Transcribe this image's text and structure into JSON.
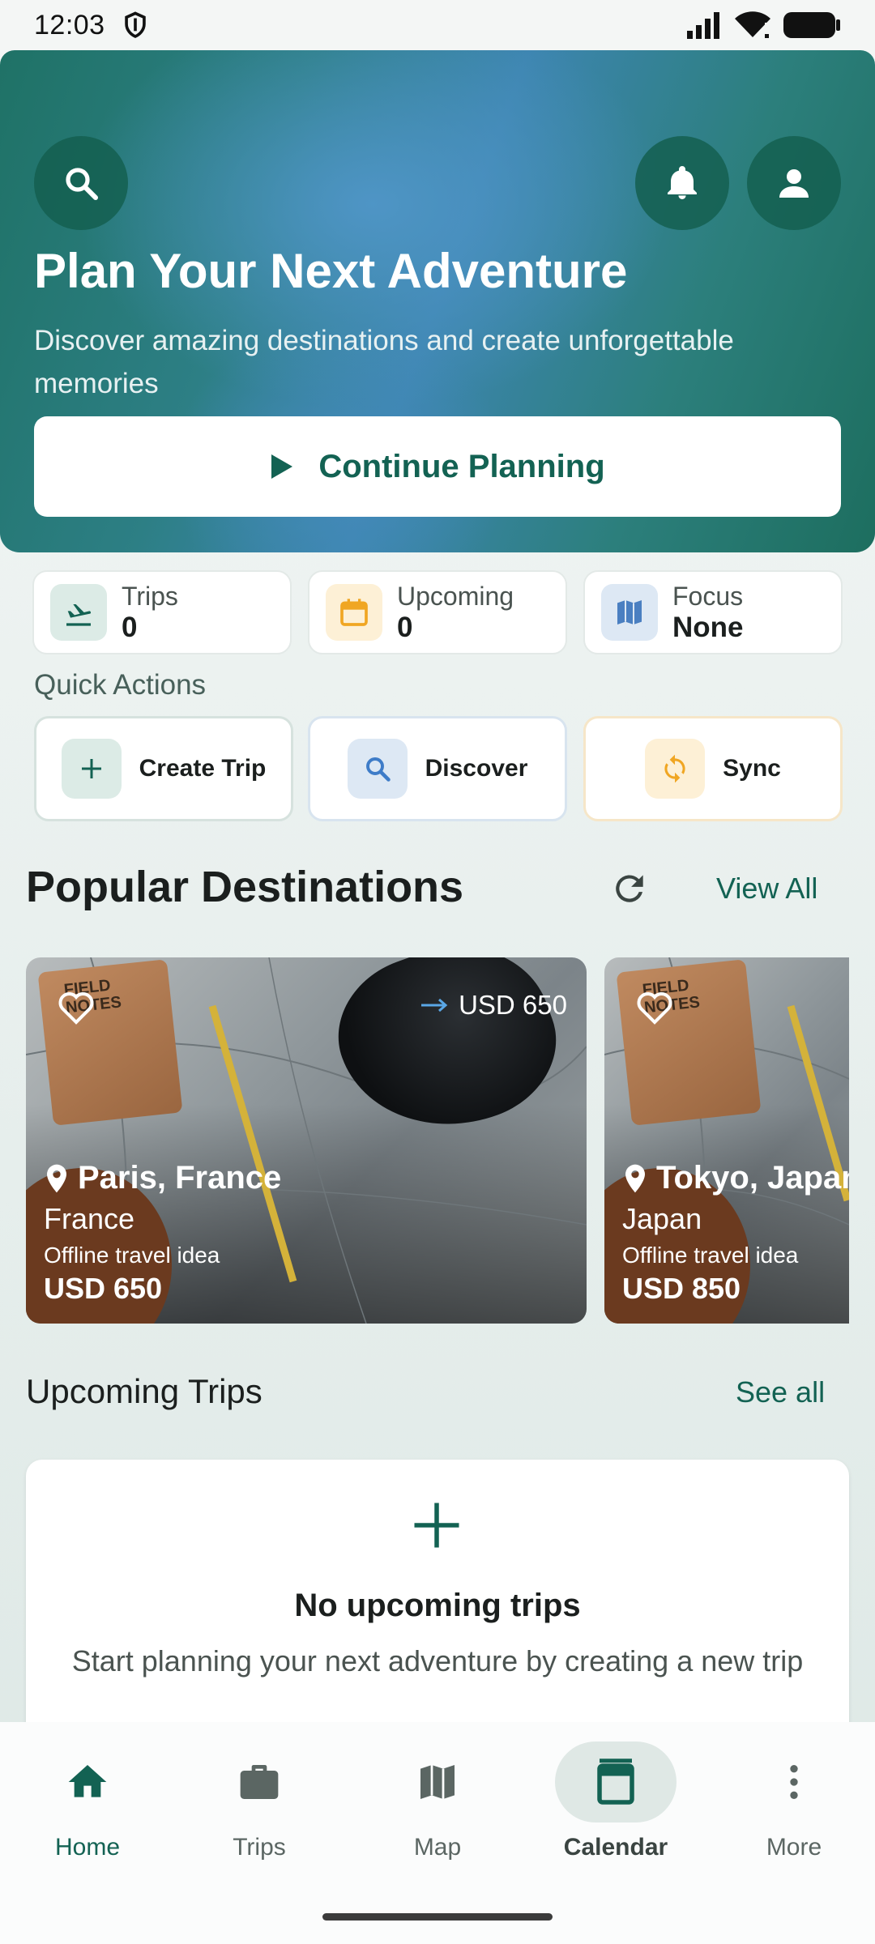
{
  "status_bar": {
    "time": "12:03",
    "icons": [
      "shield-icon",
      "signal-icon",
      "wifi-icon",
      "battery-icon"
    ]
  },
  "hero": {
    "title": "Plan Your Next Adventure",
    "subtitle": "Discover amazing destinations and create unforgettable memories",
    "cta_label": "Continue Planning",
    "icons": [
      "search-icon",
      "bell-icon",
      "person-icon",
      "play-icon"
    ]
  },
  "stats": [
    {
      "label": "Trips",
      "value": "0",
      "icon": "flight-land-icon"
    },
    {
      "label": "Upcoming",
      "value": "0",
      "icon": "calendar-icon"
    },
    {
      "label": "Focus",
      "value": "None",
      "icon": "map-icon"
    }
  ],
  "quick_actions": {
    "title": "Quick Actions",
    "items": [
      {
        "label": "Create Trip",
        "icon": "plus-icon"
      },
      {
        "label": "Discover",
        "icon": "search-icon"
      },
      {
        "label": "Sync",
        "icon": "sync-icon"
      }
    ]
  },
  "popular": {
    "title": "Popular Destinations",
    "view_all": "View All",
    "cards": [
      {
        "name": "Paris, France",
        "country": "France",
        "note": "Offline travel idea",
        "price": "USD 650",
        "tag_price": "USD 650"
      },
      {
        "name": "Tokyo, Japan",
        "country": "Japan",
        "note": "Offline travel idea",
        "price": "USD 850"
      }
    ]
  },
  "upcoming": {
    "title": "Upcoming Trips",
    "see_all": "See all",
    "empty_title": "No upcoming trips",
    "empty_text": "Start planning your next adventure by creating a new trip"
  },
  "nav": {
    "items": [
      {
        "label": "Home",
        "icon": "home-icon",
        "active": false
      },
      {
        "label": "Trips",
        "icon": "briefcase-icon",
        "active": false
      },
      {
        "label": "Map",
        "icon": "map-icon",
        "active": false
      },
      {
        "label": "Calendar",
        "icon": "calendar-icon",
        "active": true
      },
      {
        "label": "More",
        "icon": "more-vert-icon",
        "active": false
      }
    ]
  },
  "colors": {
    "accent": "#136253",
    "hero_teal": "#1f7266",
    "hero_blue": "#3d85b0"
  }
}
